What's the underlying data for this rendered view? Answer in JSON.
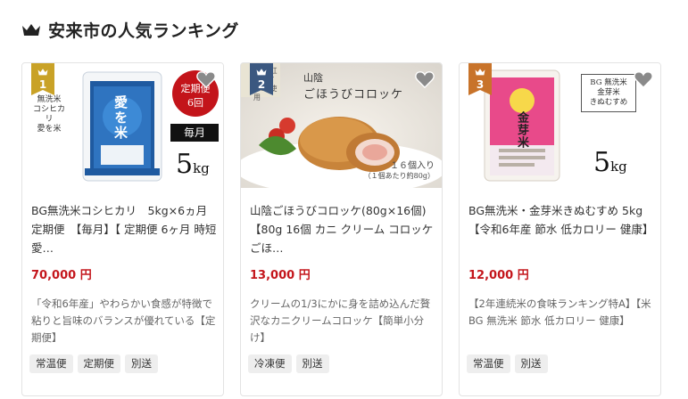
{
  "section": {
    "title": "安来市の人気ランキング",
    "icon": "crown-icon"
  },
  "colors": {
    "price": "#c4161c",
    "gold": "#c9a227",
    "navy": "#3b5880",
    "orange": "#c8732a"
  },
  "cards": [
    {
      "rank": "1",
      "rank_color": "#c9a227",
      "name": "BG無洗米コシヒカリ　5kg×6ヵ月定期便　【毎月】【 定期便 6ヶ月 時短 愛…",
      "price": "70,000 円",
      "desc": "「令和6年産」やわらかい食感が特徴で粘りと旨味のバランスが優れている【定期便】",
      "tags": [
        "常温便",
        "定期便",
        "別送"
      ],
      "thumb": {
        "side_lines": [
          "無洗米",
          "コシヒカリ",
          "愛を米"
        ],
        "bag_title": "愛を米",
        "badge_line1": "定期便",
        "badge_line2": "6回",
        "monthly": "毎月",
        "weight": "5",
        "unit": "kg"
      }
    },
    {
      "rank": "2",
      "rank_color": "#3b5880",
      "name": "山陰ごほうびコロッケ(80g×16個)【80g 16個 カニ クリーム コロッケ ごほ…",
      "price": "13,000 円",
      "desc": "クリームの1/3にかに身を詰め込んだ贅沢なカニクリームコロッケ【簡単小分け】",
      "tags": [
        "冷凍便",
        "別送"
      ],
      "thumb": {
        "region": "山陰",
        "product": "ごほうびコロッケ",
        "count_line1": "１６個入り",
        "count_line2": "（１個あたり約80g）",
        "corner_tag": "県産 紅ズワイガニ 使用"
      }
    },
    {
      "rank": "3",
      "rank_color": "#c8732a",
      "name": "BG無洗米・金芽米きぬむすめ 5kg【令和6年産 節水 低カロリー 健康】",
      "price": "12,000 円",
      "desc": "【2年連続米の食味ランキング特A】【米 BG 無洗米 節水 低カロリー 健康】",
      "tags": [
        "常温便",
        "別送"
      ],
      "thumb": {
        "label_line1": "BG 無洗米",
        "label_line2": "金芽米",
        "label_line3": "きぬむすめ",
        "bag_title": "金芽米",
        "weight": "5",
        "unit": "kg"
      }
    }
  ]
}
